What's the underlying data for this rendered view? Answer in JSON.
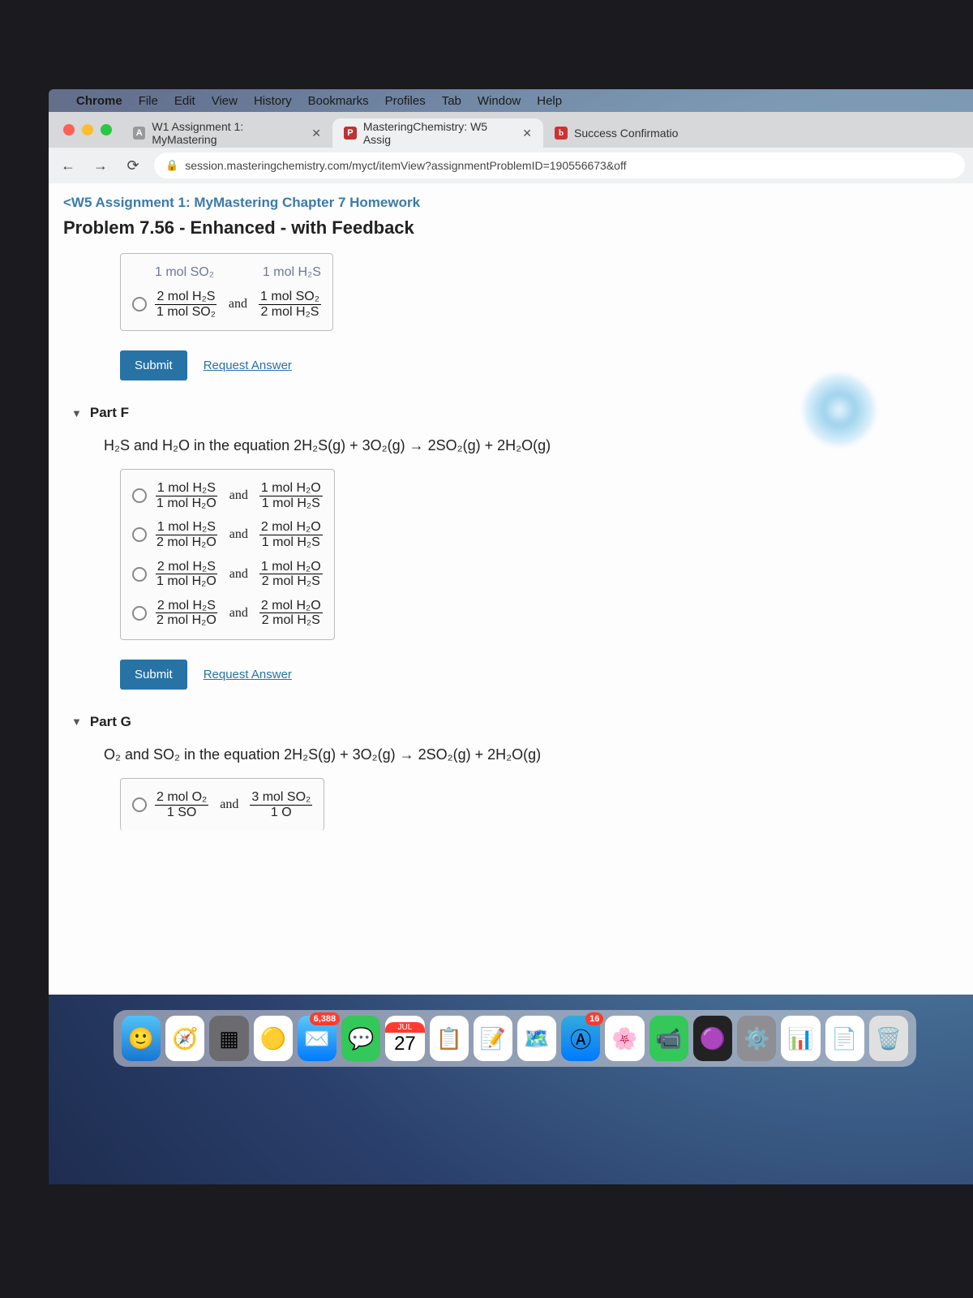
{
  "menubar": {
    "app": "Chrome",
    "items": [
      "File",
      "Edit",
      "View",
      "History",
      "Bookmarks",
      "Profiles",
      "Tab",
      "Window",
      "Help"
    ]
  },
  "tabs": [
    {
      "label": "W1 Assignment 1: MyMastering",
      "active": false,
      "fav": "w1"
    },
    {
      "label": "MasteringChemistry: W5 Assig",
      "active": true,
      "fav": "mc"
    },
    {
      "label": "Success Confirmatio",
      "active": false,
      "fav": "b"
    }
  ],
  "url": "session.masteringchemistry.com/myct/itemView?assignmentProblemID=190556673&off",
  "breadcrumb": "<W5 Assignment 1: MyMastering Chapter 7 Homework",
  "problem_title": "Problem 7.56 - Enhanced - with Feedback",
  "partE": {
    "ghost_left": "1 mol SO₂",
    "ghost_right": "1 mol H₂S",
    "opt": {
      "l_num": "2 mol H₂S",
      "l_den": "1 mol SO₂",
      "r_num": "1 mol SO₂",
      "r_den": "2 mol H₂S"
    },
    "submit": "Submit",
    "request": "Request Answer"
  },
  "partF": {
    "heading": "Part F",
    "prompt_pre": "H₂S and H₂O in the equation ",
    "prompt_eq": "2H₂S(g) + 3O₂(g) → 2SO₂(g) + 2H₂O(g)",
    "options": [
      {
        "l_num": "1 mol H₂S",
        "l_den": "1 mol H₂O",
        "r_num": "1 mol H₂O",
        "r_den": "1 mol H₂S"
      },
      {
        "l_num": "1 mol H₂S",
        "l_den": "2 mol H₂O",
        "r_num": "2 mol H₂O",
        "r_den": "1 mol H₂S"
      },
      {
        "l_num": "2 mol H₂S",
        "l_den": "1 mol H₂O",
        "r_num": "1 mol H₂O",
        "r_den": "2 mol H₂S"
      },
      {
        "l_num": "2 mol H₂S",
        "l_den": "2 mol H₂O",
        "r_num": "2 mol H₂O",
        "r_den": "2 mol H₂S"
      }
    ],
    "submit": "Submit",
    "request": "Request Answer"
  },
  "partG": {
    "heading": "Part G",
    "prompt_pre": "O₂ and SO₂ in the equation ",
    "prompt_eq": "2H₂S(g) + 3O₂(g) → 2SO₂(g) + 2H₂O(g)",
    "opt": {
      "l_num": "2 mol O₂",
      "l_den": "1 SO",
      "r_num": "3 mol SO₂",
      "r_den": "1 O"
    }
  },
  "and": "and",
  "dock": {
    "mail_badge": "6,388",
    "cal_month": "JUL",
    "cal_day": "27",
    "store_badge": "16"
  }
}
